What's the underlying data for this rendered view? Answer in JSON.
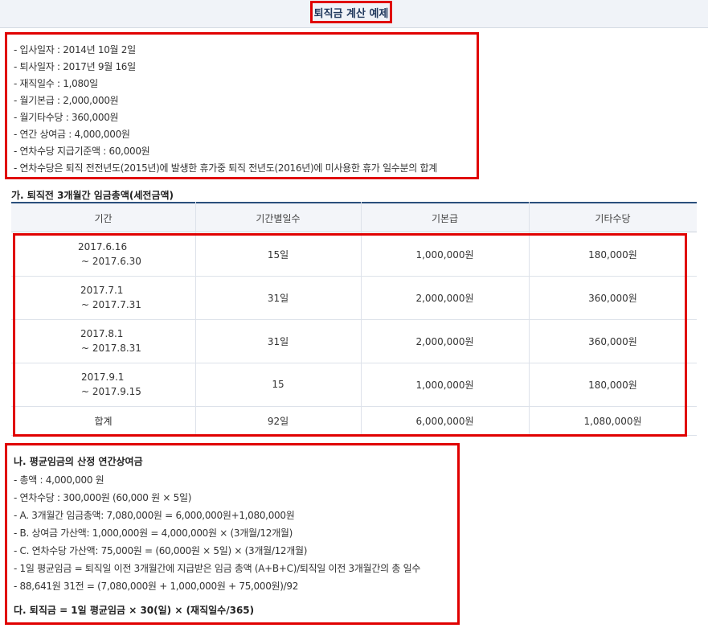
{
  "title": "퇴직금 계산 예제",
  "info": [
    "- 입사일자 : 2014년 10월 2일",
    "- 퇴사일자 : 2017년 9월 16일",
    "- 재직일수 : 1,080일",
    "- 월기본급 : 2,000,000원",
    "- 월기타수당 : 360,000원",
    "- 연간 상여금 : 4,000,000원",
    "- 연차수당 지급기준액 : 60,000원",
    "- 연차수당은 퇴직 전전년도(2015년)에 발생한 휴가중 퇴직 전년도(2016년)에 미사용한 휴가 일수분의 합계"
  ],
  "section_ga": "가. 퇴직전 3개월간 임금총액(세전금액)",
  "table": {
    "headers": [
      "기간",
      "기간별일수",
      "기본급",
      "기타수당"
    ],
    "rows": [
      {
        "period_start": "2017.6.16",
        "period_end": "~ 2017.6.30",
        "days": "15일",
        "base": "1,000,000원",
        "other": "180,000원"
      },
      {
        "period_start": "2017.7.1",
        "period_end": "~ 2017.7.31",
        "days": "31일",
        "base": "2,000,000원",
        "other": "360,000원"
      },
      {
        "period_start": "2017.8.1",
        "period_end": "~ 2017.8.31",
        "days": "31일",
        "base": "2,000,000원",
        "other": "360,000원"
      },
      {
        "period_start": "2017.9.1",
        "period_end": "~ 2017.9.15",
        "days": "15",
        "base": "1,000,000원",
        "other": "180,000원"
      }
    ],
    "total": {
      "label": "합계",
      "days": "92일",
      "base": "6,000,000원",
      "other": "1,080,000원"
    }
  },
  "section_na": "나. 평균임금의 산정 연간상여금",
  "calc": [
    "- 총액 : 4,000,000 원",
    "- 연차수당 : 300,000원 (60,000 원 × 5일)",
    "- A. 3개월간 임금총액: 7,080,000원 = 6,000,000원+1,080,000원",
    "- B. 상여금 가산액: 1,000,000원 = 4,000,000원 × (3개월/12개월)",
    "- C. 연차수당 가산액: 75,000원 = (60,000원 × 5일) × (3개월/12개월)",
    "- 1일 평균임금 = 퇴직일 이전 3개월간에 지급받은 임금 총액 (A+B+C)/퇴직일 이전 3개월간의 총 일수",
    "- 88,641원 31전 = (7,080,000원 + 1,000,000원 + 75,000원)/92"
  ],
  "section_da": "다. 퇴직금 = 1일 평균임금 × 30(일) × (재직일수/365)"
}
